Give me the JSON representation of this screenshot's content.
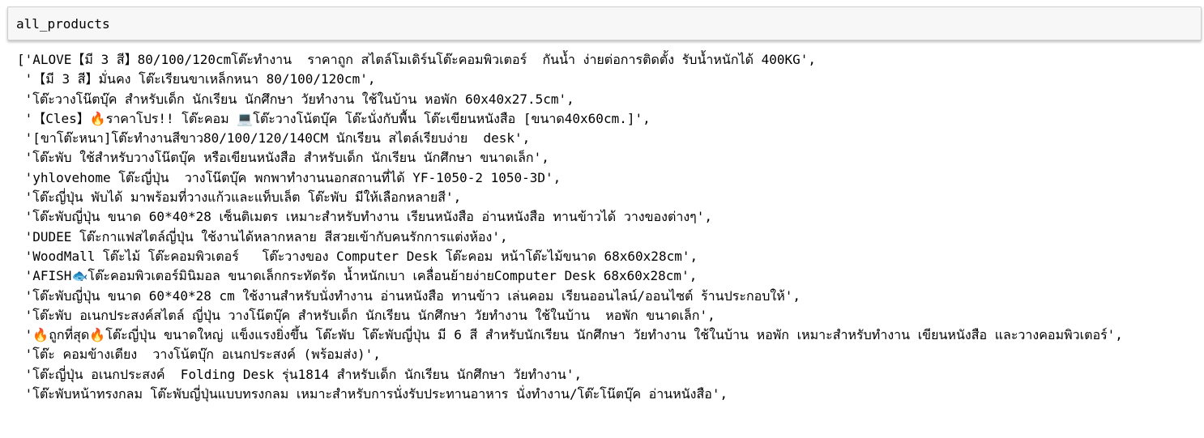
{
  "input": {
    "code": "all_products"
  },
  "output": {
    "lines": [
      "['ALOVE【มี 3 สี】80/100/120cmโต๊ะทำงาน  ราคาถูก สไตล์โมเดิร์นโต๊ะคอมพิวเตอร์  กันน้ำ ง่ายต่อการติดตั้ง รับน้ำหนักได้ 400KG',",
      " '【มี 3 สี】มั่นคง โต๊ะเรียนขาเหล็กหนา 80/100/120cm',",
      " 'โต๊ะวางโน๊ตบุ๊ค สำหรับเด็ก นักเรียน นักศึกษา วัยทำงาน ใช้ในบ้าน หอพัก 60x40x27.5cm',",
      " '【Cles】🔥ราคาโปร!! โต๊ะคอม 💻โต๊ะวางโน้ตบุ๊ค โต๊ะนั่งกับพื้น โต๊ะเขียนหนังสือ [ขนาด40x60cm.]',",
      " '[ขาโต๊ะหนา]โต๊ะทำงานสีขาว80/100/120/140CM นักเรียน สไตล์เรียบง่าย  desk',",
      " 'โต๊ะพับ ใช้สำหรับวางโน๊ตบุ๊ค หรือเขียนหนังสือ สำหรับเด็ก นักเรียน นักศึกษา ขนาดเล็ก',",
      " 'yhlovehome โต๊ะญี่ปุ่น  วางโน๊ตบุ๊ค พกพาทำงานนอกสถานที่ได้ YF-1050-2 1050-3D',",
      " 'โต๊ะญี่ปุ่น พับได้ มาพร้อมที่วางแก้วและแท็บเล็ต โต๊ะพับ มีให้เลือกหลายสี',",
      " 'โต๊ะพับญี่ปุ่น ขนาด 60*40*28 เซ็นติเมตร เหมาะสำหรับทำงาน เรียนหนังสือ อ่านหนังสือ ทานข้าวได้ วางของต่างๆ',",
      " 'DUDEE โต๊ะกาแฟสไตล์ญี่ปุ่น ใช้งานได้หลากหลาย สีสวยเข้ากับคนรักการแต่งห้อง',",
      " 'WoodMall โต๊ะไม้ โต๊ะคอมพิวเตอร์   โต๊ะวางของ Computer Desk โต๊ะคอม หน้าโต๊ะไม้ขนาด 68x60x28cm',",
      " 'AFISH🐟โต๊ะคอมพิวเตอร์มินิมอล ขนาดเล็กกระทัดรัด น้ำหนักเบา เคลื่อนย้ายง่ายComputer Desk 68x60x28cm',",
      " 'โต๊ะพับญี่ปุ่น ขนาด 60*40*28 cm ใช้งานสำหรับนั่งทำงาน อ่านหนังสือ ทานข้าว เล่นคอม เรียนออนไลน์/ออนไซต์ ร้านประกอบให้',",
      " 'โต๊ะพับ อเนกประสงค์สไตล์ ญี่ปุ่น วางโน๊ตบุ๊ค สำหรับเด็ก นักเรียน นักศึกษา วัยทำงาน ใช้ในบ้าน  หอพัก ขนาดเล็ก',",
      " '🔥ถูกที่สุด🔥โต๊ะญี่ปุ่น ขนาดใหญ่ แข็งแรงยิ่งขึ้น โต๊ะพับ โต๊ะพับญี่ปุ่น มี 6 สี สำหรับนักเรียน นักศึกษา วัยทำงาน ใช้ในบ้าน หอพัก เหมาะสำหรับทำงาน เขียนหนังสือ และวางคอมพิวเตอร์',",
      " 'โต๊ะ คอมข้างเตียง  วางโน้ตบุ๊ก อเนกประสงค์ (พร้อมส่ง)',",
      " 'โต๊ะญี่ปุ่น อเนกประสงค์  Folding Desk รุ่น1814 สำหรับเด็ก นักเรียน นักศึกษา วัยทำงาน',",
      " 'โต๊ะพับหน้าทรงกลม โต๊ะพับญี่ปุ่นแบบทรงกลม เหมาะสำหรับการนั่งรับประทานอาหาร นั่งทำงาน/โต๊ะโน๊ตบุ๊ค อ่านหนังสือ',"
    ]
  }
}
